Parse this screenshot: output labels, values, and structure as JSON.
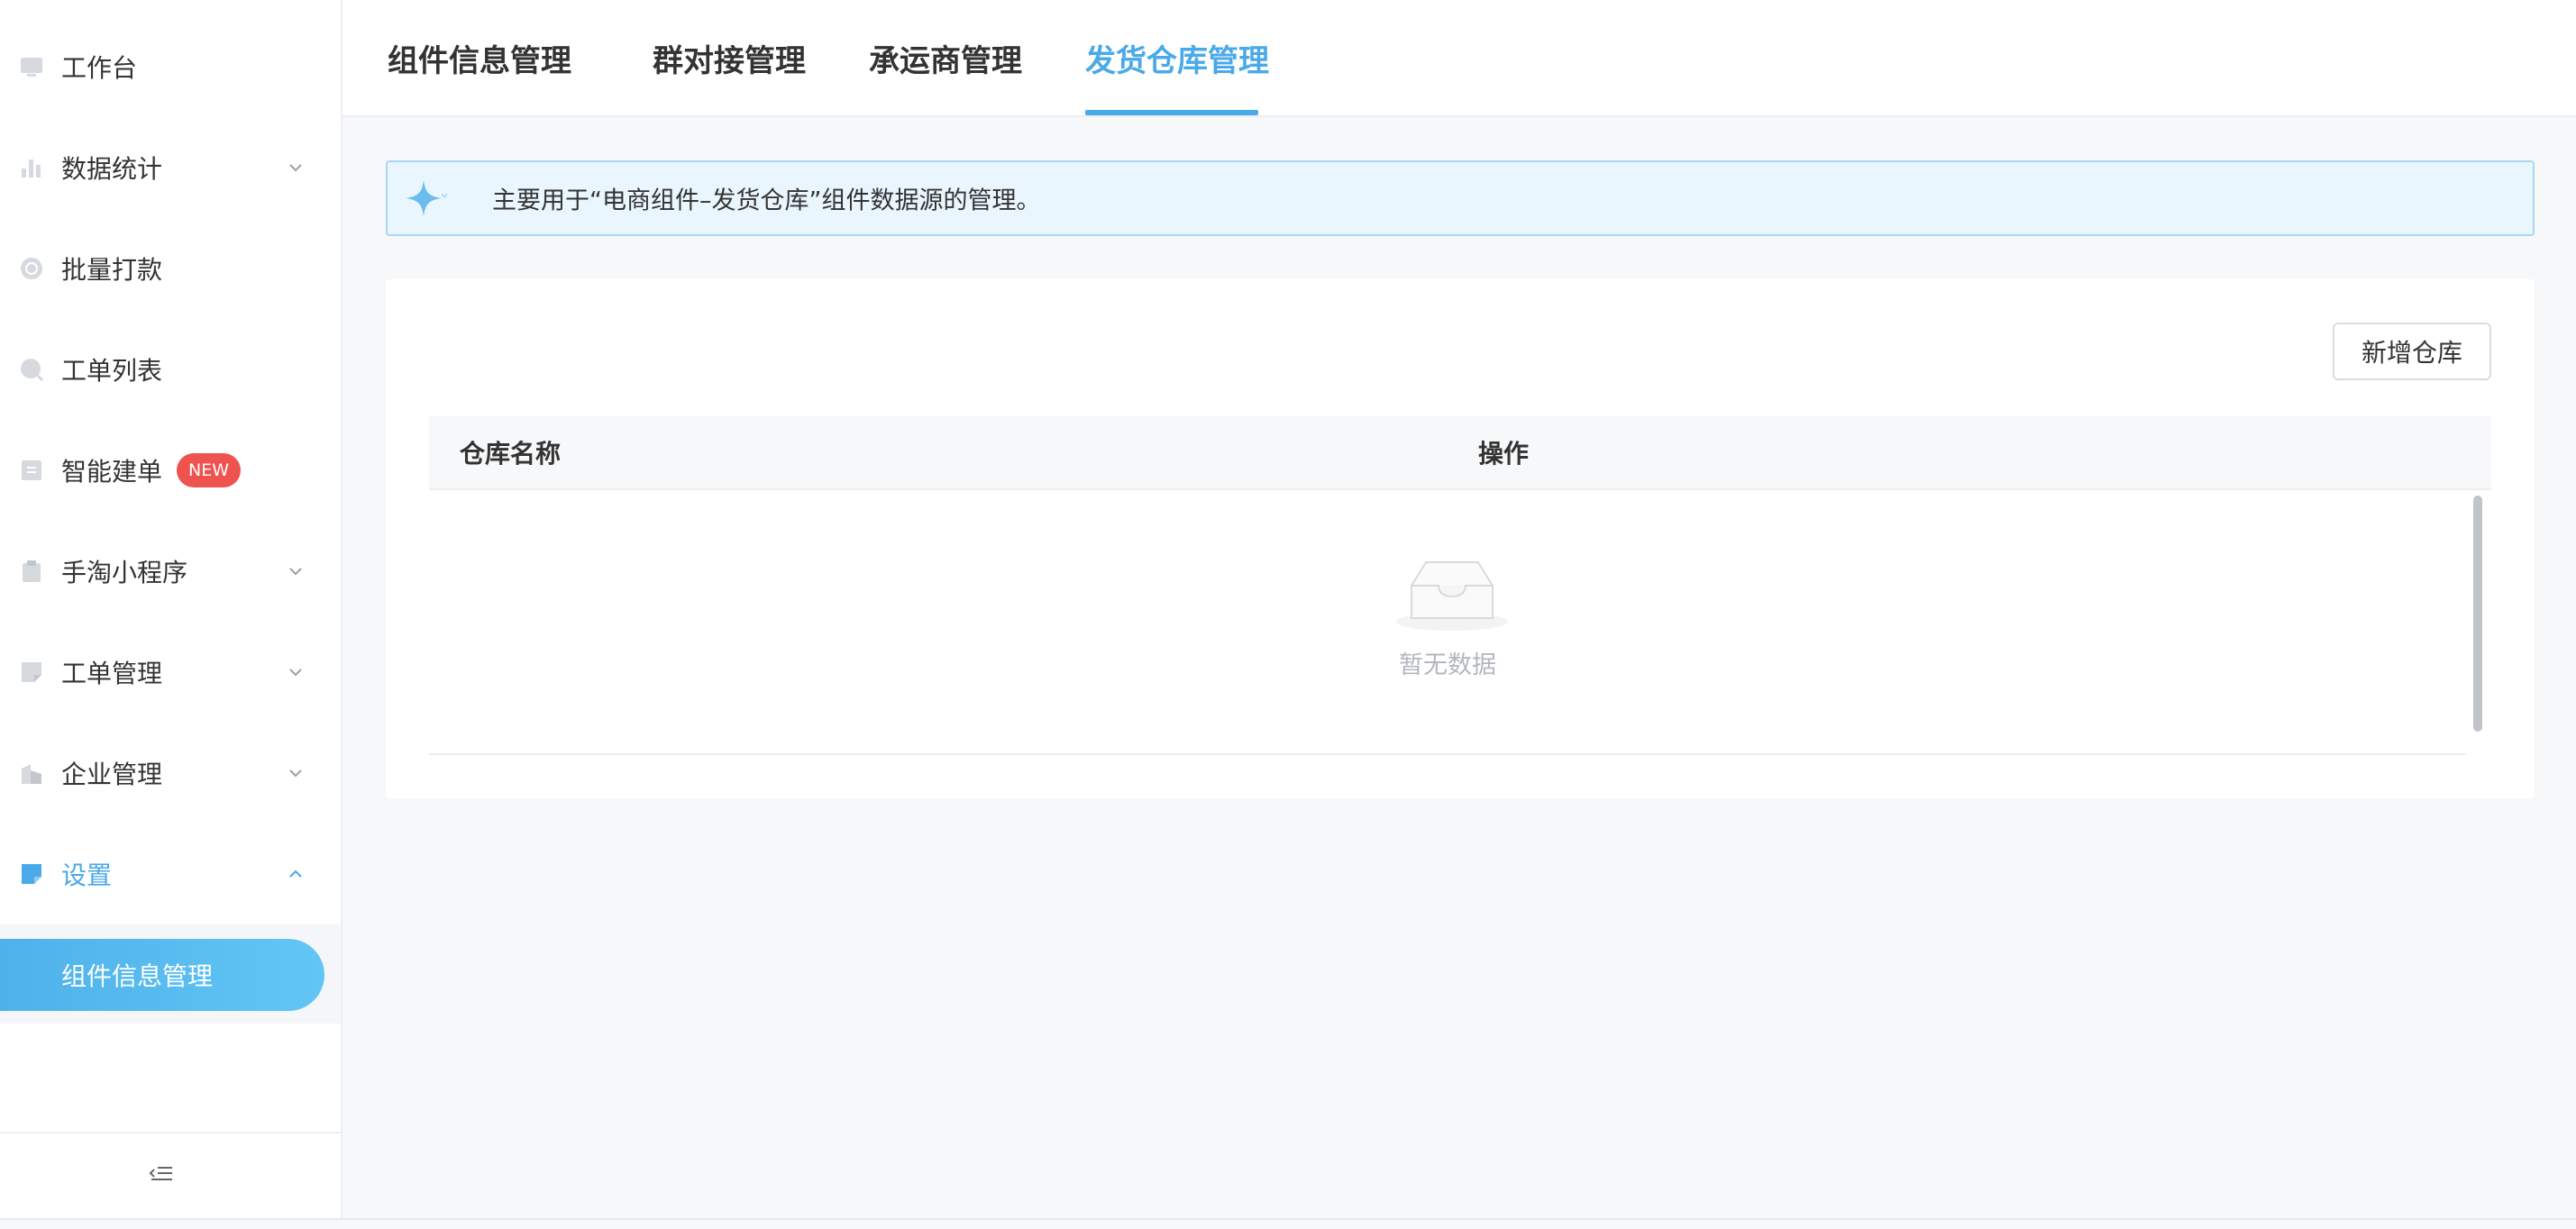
{
  "sidebar": {
    "items": [
      {
        "label": "工作台",
        "icon": "monitor-icon"
      },
      {
        "label": "数据统计",
        "icon": "bar-chart-icon",
        "expandable": true
      },
      {
        "label": "批量打款",
        "icon": "coin-icon"
      },
      {
        "label": "工单列表",
        "icon": "search-icon"
      },
      {
        "label": "智能建单",
        "icon": "doc-icon",
        "badge": "NEW"
      },
      {
        "label": "手淘小程序",
        "icon": "clipboard-icon",
        "expandable": true
      },
      {
        "label": "工单管理",
        "icon": "note-icon",
        "expandable": true
      },
      {
        "label": "企业管理",
        "icon": "building-icon",
        "expandable": true
      },
      {
        "label": "设置",
        "icon": "settings-icon",
        "expandable": true,
        "expanded": true,
        "active": true
      }
    ],
    "submenu": {
      "label": "组件信息管理",
      "active": true
    }
  },
  "tabs": [
    {
      "label": "组件信息管理"
    },
    {
      "label": "群对接管理"
    },
    {
      "label": "承运商管理"
    },
    {
      "label": "发货仓库管理",
      "active": true
    }
  ],
  "alert": {
    "text": "主要用于“电商组件–发货仓库”组件数据源的管理。"
  },
  "toolbar": {
    "add_label": "新增仓库"
  },
  "table": {
    "columns": [
      "仓库名称",
      "操作"
    ],
    "rows": [],
    "empty_text": "暂无数据"
  },
  "colors": {
    "accent": "#4aa9e8",
    "badge": "#ef5350"
  }
}
